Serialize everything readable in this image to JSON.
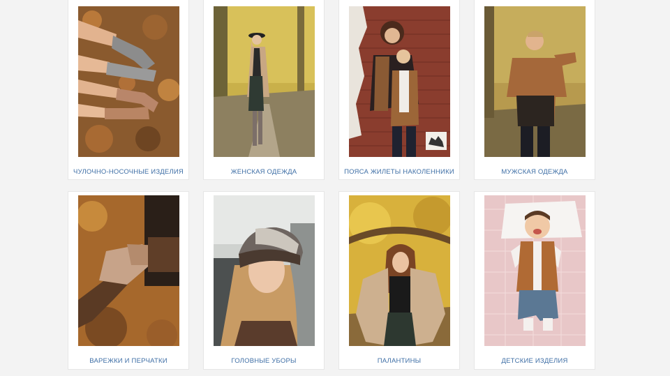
{
  "categories": [
    {
      "label": "ЧУЛОЧНО-НОСОЧНЫЕ ИЗДЕЛИЯ",
      "image": "socks-on-autumn-leaves-photo"
    },
    {
      "label": "ЖЕНСКАЯ ОДЕЖДА",
      "image": "woman-in-coat-park-photo"
    },
    {
      "label": "ПОЯСА ЖИЛЕТЫ НАКОЛЕННИКИ",
      "image": "mother-daughter-vests-photo"
    },
    {
      "label": "МУЖСКАЯ ОДЕЖДА",
      "image": "man-in-sweater-photo"
    },
    {
      "label": "ВАРЕЖКИ И ПЕРЧАТКИ",
      "image": "hands-in-mittens-photo"
    },
    {
      "label": "ГОЛОВНЫЕ УБОРЫ",
      "image": "woman-in-knit-hat-photo"
    },
    {
      "label": "ПАЛАНТИНЫ",
      "image": "woman-with-stole-photo"
    },
    {
      "label": "ДЕТСКИЕ ИЗДЕЛИЯ",
      "image": "baby-in-vest-photo"
    }
  ],
  "colors": {
    "caption": "#3f6fa6",
    "background": "#f3f3f3",
    "card": "#ffffff"
  }
}
